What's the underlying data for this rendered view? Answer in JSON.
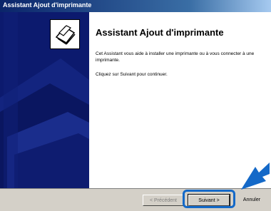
{
  "window": {
    "title": "Assistant Ajout d'imprimante"
  },
  "wizard": {
    "heading": "Assistant Ajout d'imprimante",
    "description": "Cet Assistant vous aide à installer une imprimante ou à vous connecter à une imprimante.",
    "instruction": "Cliquez sur Suivant pour continuer."
  },
  "buttons": {
    "back": "< Précédent",
    "next": "Suivant >",
    "cancel": "Annuler"
  },
  "colors": {
    "sidebar": "#0c1a6e",
    "highlight": "#1469c8"
  }
}
